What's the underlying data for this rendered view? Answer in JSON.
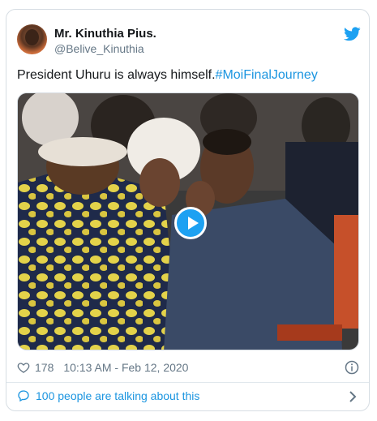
{
  "tweet": {
    "author_name": "Mr. Kinuthia Pius.",
    "author_handle": "@Belive_Kinuthia",
    "text": "President Uhuru is always himself.",
    "hashtag": "#MoiFinalJourney",
    "like_count": "178",
    "timestamp": "10:13 AM - Feb 12, 2020",
    "talking": "100 people are talking about this"
  },
  "icons": {
    "brand": "twitter-bird-icon",
    "like": "heart-icon",
    "info": "info-icon",
    "reply": "speech-bubble-icon",
    "more": "chevron-right-icon"
  },
  "colors": {
    "accent": "#1da1f2",
    "link": "#1b95e0",
    "text": "#14171a",
    "muted": "#657786"
  }
}
